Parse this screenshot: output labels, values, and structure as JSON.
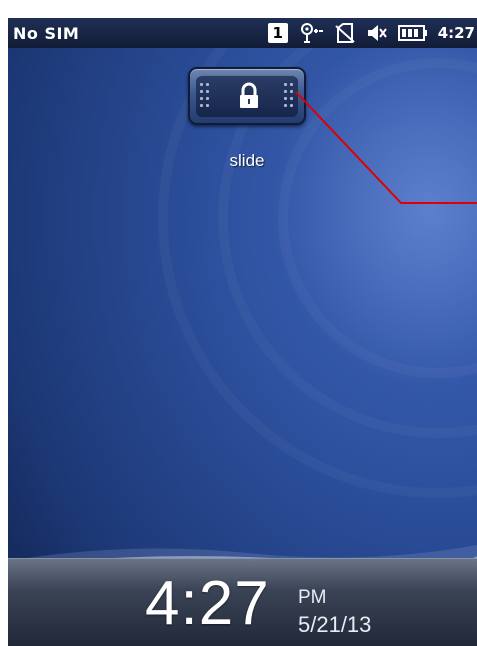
{
  "status_bar": {
    "carrier": "No SIM",
    "badge": "1",
    "time": "4:27",
    "icons": [
      "notification-badge-icon",
      "connectivity-icon",
      "no-sim-icon",
      "volume-muted-icon",
      "battery-icon"
    ]
  },
  "lock": {
    "label": "slide",
    "icon": "padlock-icon"
  },
  "clock": {
    "time": "4:27",
    "ampm": "PM",
    "date": "5/21/13"
  },
  "colors": {
    "background": "#2c4f9c",
    "statusbar": "#121c36",
    "annotation_line": "#e00000"
  }
}
